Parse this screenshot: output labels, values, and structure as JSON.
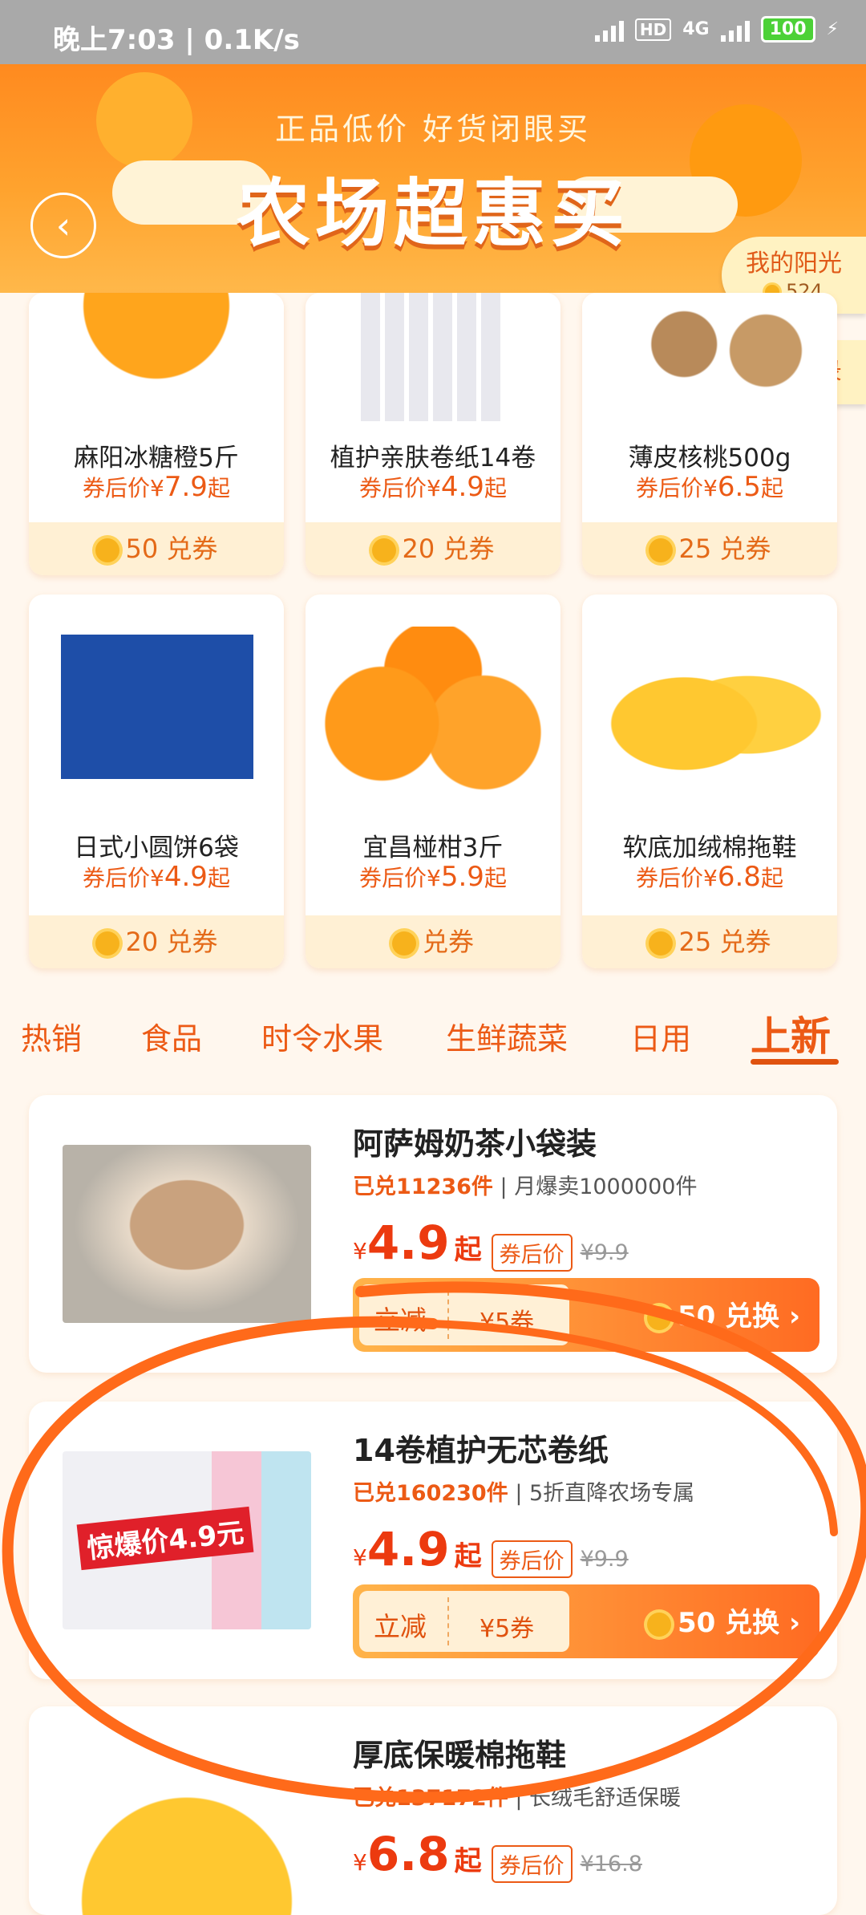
{
  "status_bar": {
    "time": "晚上7:03 | 0.1K/s",
    "hd": "HD",
    "net": "4G",
    "battery": "100"
  },
  "banner": {
    "subtitle": "正品低价 好货闭眼买",
    "title": "农场超惠买"
  },
  "sunshine": {
    "label": "我的阳光",
    "value": "524"
  },
  "exchange_record": "兑换记录",
  "grid_products": [
    {
      "name": "麻阳冰糖橙5斤",
      "price_prefix": "券后价¥",
      "price": "7.9",
      "price_suffix": "起",
      "coupon": "50 兑券"
    },
    {
      "name": "植护亲肤卷纸14卷",
      "price_prefix": "券后价¥",
      "price": "4.9",
      "price_suffix": "起",
      "coupon": "20 兑券"
    },
    {
      "name": "薄皮核桃500g",
      "price_prefix": "券后价¥",
      "price": "6.5",
      "price_suffix": "起",
      "coupon": "25 兑券"
    },
    {
      "name": "日式小圆饼6袋",
      "price_prefix": "券后价¥",
      "price": "4.9",
      "price_suffix": "起",
      "coupon": "20 兑券"
    },
    {
      "name": "宜昌椪柑3斤",
      "price_prefix": "券后价¥",
      "price": "5.9",
      "price_suffix": "起",
      "coupon": "兑券"
    },
    {
      "name": "软底加绒棉拖鞋",
      "price_prefix": "券后价¥",
      "price": "6.8",
      "price_suffix": "起",
      "coupon": "25 兑券"
    }
  ],
  "tabs": [
    "热销",
    "食品",
    "时令水果",
    "生鲜蔬菜",
    "日用",
    "上新"
  ],
  "active_tab": "上新",
  "list_products": [
    {
      "title": "阿萨姆奶茶小袋装",
      "sold": "已兑11236件",
      "meta": " | 月爆卖1000000件",
      "currency": "¥",
      "price": "4.9",
      "qi": "起",
      "tag": "券后价",
      "orig": "¥9.9",
      "discount": "立减",
      "coupon": "¥5券",
      "exchange": "50 兑换 ›"
    },
    {
      "title": "14卷植护无芯卷纸",
      "sold": "已兑160230件",
      "meta": " | 5折直降农场专属",
      "currency": "¥",
      "price": "4.9",
      "qi": "起",
      "tag": "券后价",
      "orig": "¥9.9",
      "discount": "立减",
      "coupon": "¥5券",
      "exchange": "50 兑换 ›",
      "badge": "惊爆价4.9元"
    },
    {
      "title": "厚底保暖棉拖鞋",
      "sold": "已兑137172件",
      "meta": " | 长绒毛舒适保暖",
      "currency": "¥",
      "price": "6.8",
      "qi": "起",
      "tag": "券后价",
      "orig": "¥16.8"
    }
  ],
  "colors": {
    "accent": "#ec5a15",
    "banner": "#ff8a1f",
    "annotation": "#ff6a1a"
  }
}
